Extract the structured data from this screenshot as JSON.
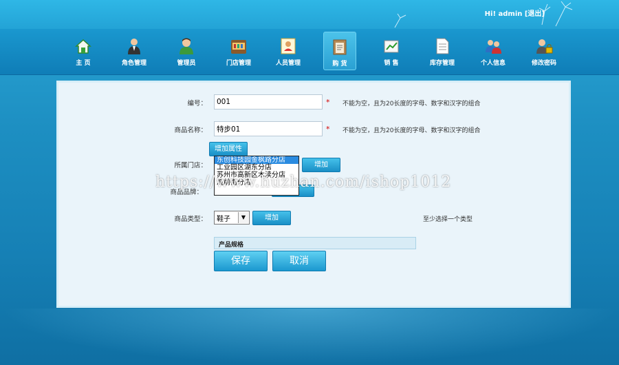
{
  "header": {
    "greeting": "Hi! admin",
    "logout": "[退出]"
  },
  "nav": [
    {
      "label": "主  页",
      "icon": "home-icon"
    },
    {
      "label": "角色管理",
      "icon": "role-icon"
    },
    {
      "label": "管理员",
      "icon": "admin-icon"
    },
    {
      "label": "门店管理",
      "icon": "store-icon"
    },
    {
      "label": "人员管理",
      "icon": "staff-icon"
    },
    {
      "label": "购  货",
      "icon": "purchase-icon",
      "active": true
    },
    {
      "label": "销  售",
      "icon": "sales-icon"
    },
    {
      "label": "库存管理",
      "icon": "inventory-icon"
    },
    {
      "label": "个人信息",
      "icon": "profile-icon"
    },
    {
      "label": "修改密码",
      "icon": "password-icon"
    }
  ],
  "form": {
    "code": {
      "label": "编号：",
      "value": "001",
      "required": "*",
      "hint": "不能为空，且为20长度的字母、数字和汉字的组合"
    },
    "name": {
      "label": "商品名称：",
      "value": "特步01",
      "required": "*",
      "hint": "不能为空，且为20长度的字母、数字和汉字的组合"
    },
    "add_attr": "增加属性",
    "store": {
      "label": "所属门店：",
      "options": [
        "东创科技园金枫路分店",
        "工业园区湖东分店",
        "苏州市高新区木渎分店",
        "观前街分店"
      ],
      "add_button": "增加"
    },
    "hidden_label": "商品品牌：",
    "type": {
      "label": "商品类型：",
      "selected": "鞋子",
      "add_button": "增加",
      "hint": "至少选择一个类型"
    },
    "spec_title": "产品规格",
    "save": "保存",
    "cancel": "取消"
  },
  "watermark": "https://www.huzhan.com/ishop1012"
}
